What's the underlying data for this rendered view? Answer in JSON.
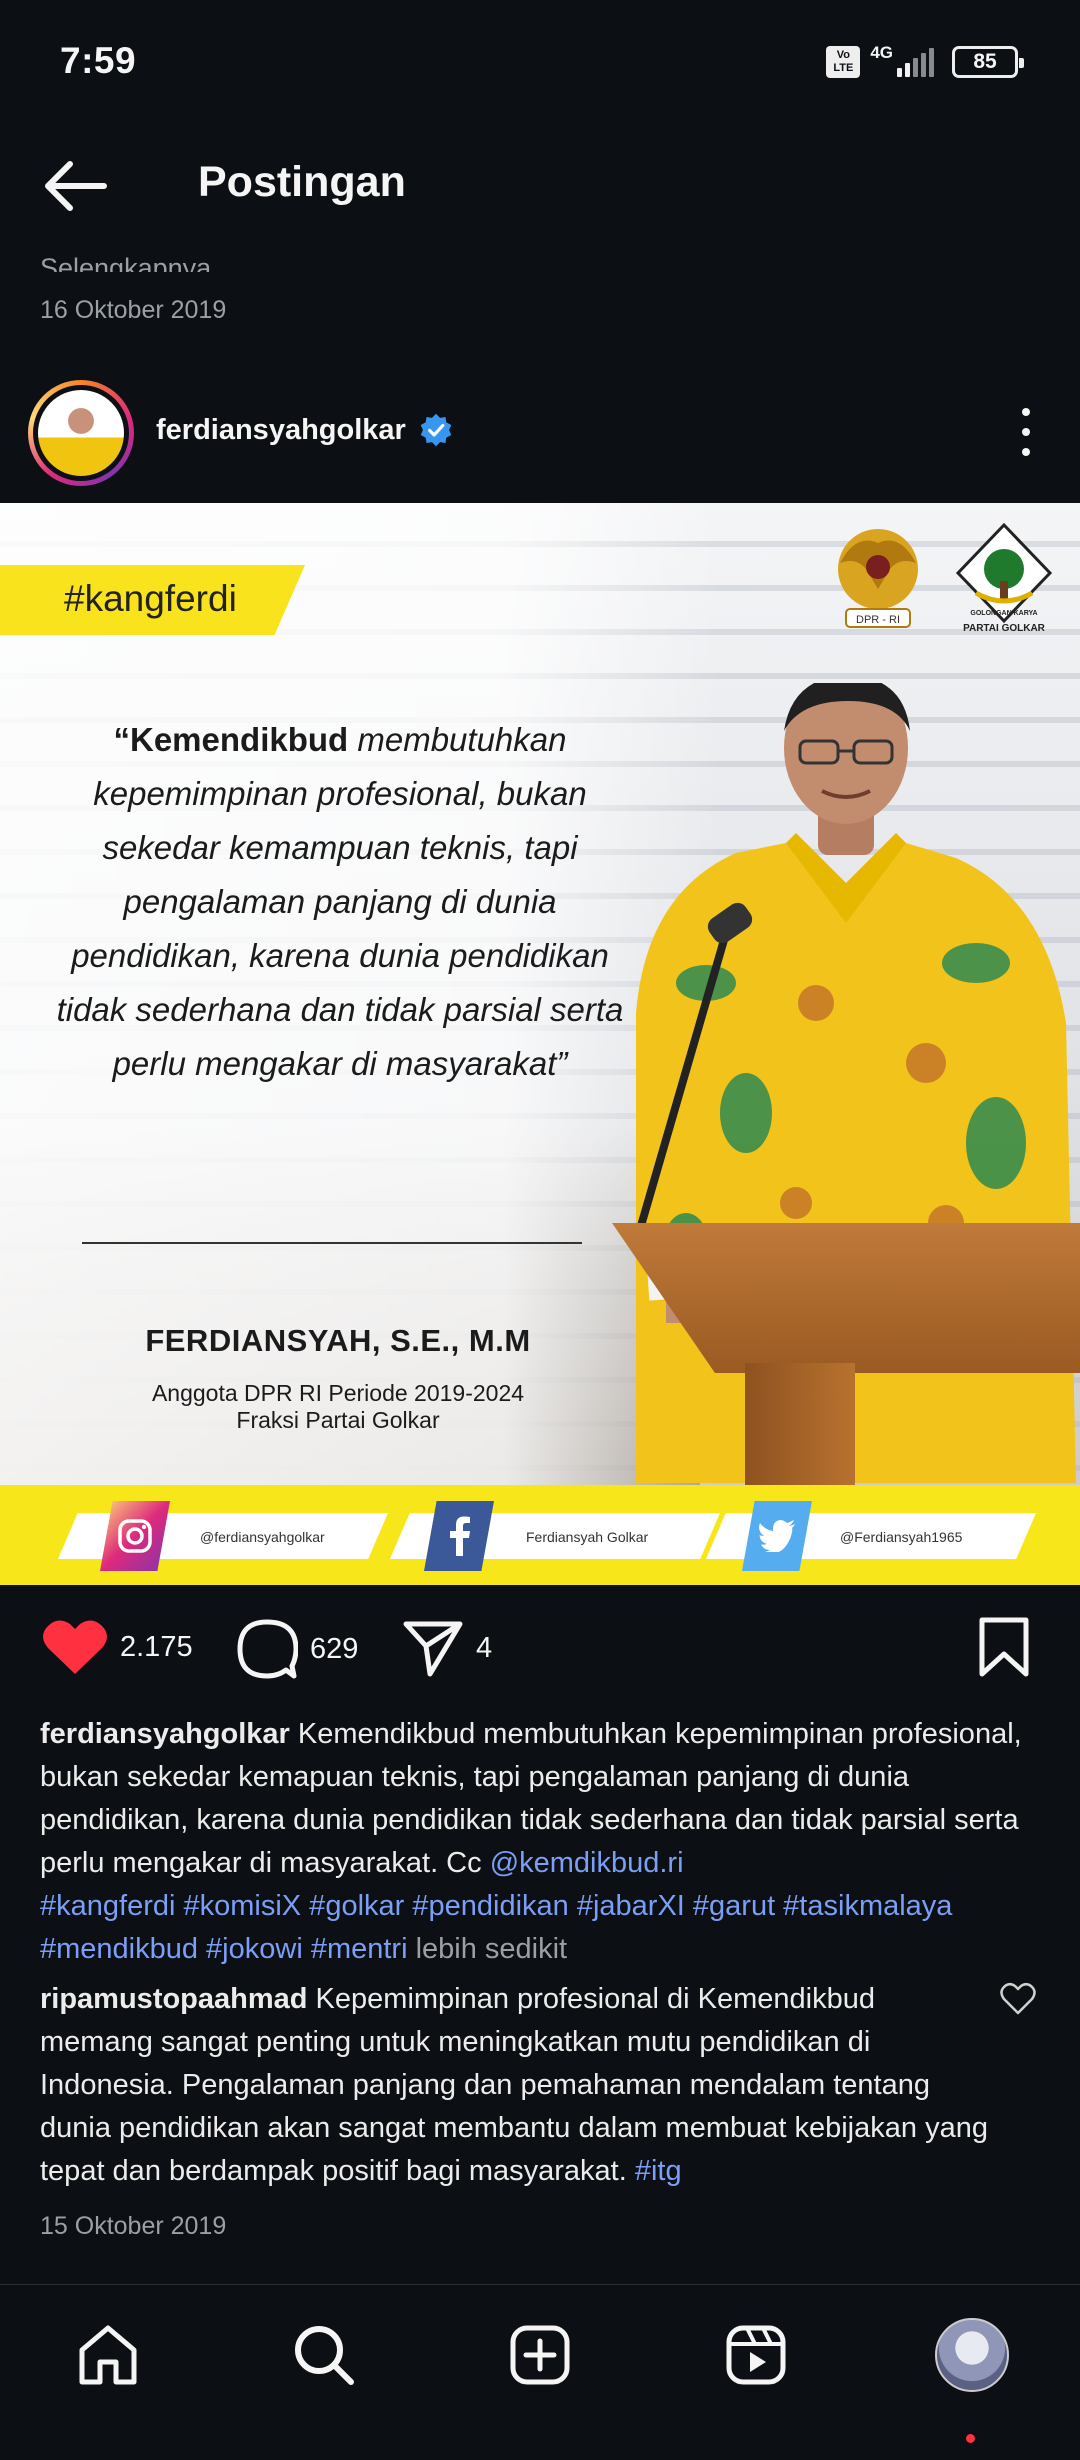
{
  "status_bar": {
    "time": "7:59",
    "volte": "Vo LTE",
    "network": "4G",
    "battery": "85"
  },
  "header": {
    "title": "Postingan"
  },
  "previous_post": {
    "cut_text": "Selengkapnya",
    "date": "16 Oktober 2019"
  },
  "post": {
    "username": "ferdiansyahgolkar",
    "image": {
      "hashtag": "#kangferdi",
      "quote_lead": "“Kemendikbud",
      "quote_rest": " membutuhkan kepemimpinan profesional, bukan sekedar kemampuan teknis, tapi pengalaman panjang di dunia pendidikan, karena dunia pendidikan tidak sederhana dan tidak parsial serta perlu mengakar di masyarakat”",
      "speaker_name": "FERDIANSYAH, S.E., M.M",
      "speaker_role_1": "Anggota DPR RI Periode 2019-2024",
      "speaker_role_2": "Fraksi Partai Golkar",
      "logo_dpr_text": "DPR - RI",
      "logo_golkar_text_1": "GOLONGAN KARYA",
      "logo_golkar_text_2": "PARTAI GOLKAR",
      "social": {
        "instagram": "@ferdiansyahgolkar",
        "facebook": "Ferdiansyah Golkar",
        "twitter": "@Ferdiansyah1965"
      }
    },
    "likes": "2.175",
    "comments": "629",
    "shares": "4",
    "caption": {
      "username": "ferdiansyahgolkar",
      "text": " Kemendikbud membutuhkan kepemimpinan profesional, bukan sekedar kemapuan teknis, tapi pengalaman panjang di dunia pendidikan, karena dunia pendidikan tidak sederhana dan tidak parsial serta perlu mengakar di masyarakat. Cc ",
      "mention": "@kemdikbud.ri",
      "hashtags": "#kangferdi #komisiX #golkar #pendidikan #jabarXI #garut #tasikmalaya #mendikbud #jokowi #mentri",
      "less": " lebih sedikit"
    },
    "comment": {
      "username": "ripamustopaahmad",
      "text": " Kepemimpinan profesional di Kemendikbud memang sangat penting untuk meningkatkan mutu pendidikan di Indonesia. Pengalaman panjang dan pemahaman mendalam tentang dunia pendidikan akan sangat membantu dalam membuat kebijakan yang tepat dan berdampak positif bagi masyarakat. ",
      "hashtag": "#itg"
    },
    "date": "15 Oktober 2019"
  },
  "colors": {
    "background": "#0c0f14",
    "like": "#ff3040",
    "link": "#7b9ff5",
    "banner_yellow": "#f8e31c",
    "verified": "#3797f0"
  },
  "icons": [
    "back-arrow-icon",
    "verified-badge-icon",
    "more-options-icon",
    "heart-icon",
    "comment-icon",
    "share-icon",
    "bookmark-icon",
    "home-icon",
    "search-icon",
    "create-icon",
    "reels-icon",
    "profile-avatar"
  ]
}
